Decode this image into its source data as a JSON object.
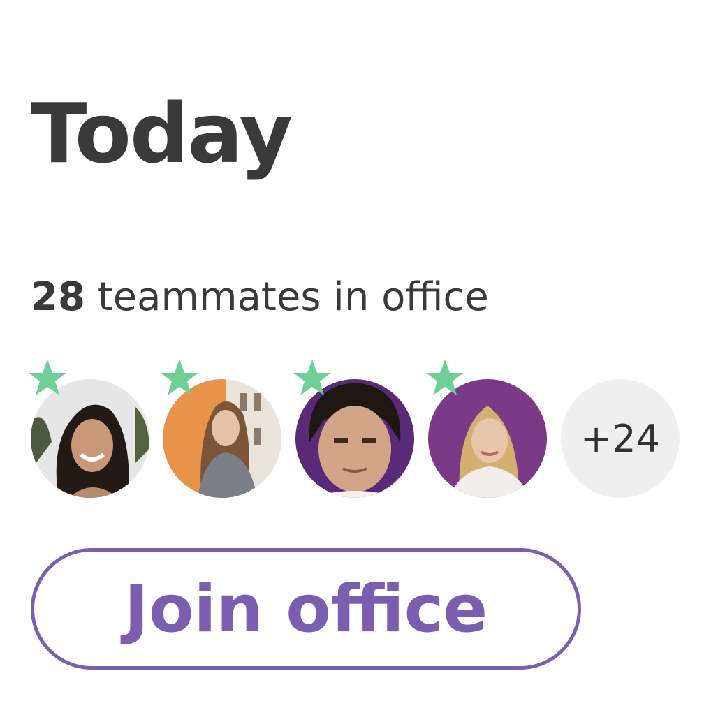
{
  "heading": "Today",
  "teammates": {
    "count": "28",
    "label": " teammates in office"
  },
  "avatars": [
    {
      "name": "avatar-1",
      "starred": true,
      "background": "#e9e9e9"
    },
    {
      "name": "avatar-2",
      "starred": true,
      "background": "#e8934a"
    },
    {
      "name": "avatar-3",
      "starred": true,
      "background": "#5a2a78"
    },
    {
      "name": "avatar-4",
      "starred": true,
      "background": "#7a3a86"
    }
  ],
  "more_count": "+24",
  "join_button": "Join office",
  "colors": {
    "accent": "#7b5eb0",
    "star": "#6fcf97",
    "text": "#3a3a3a"
  }
}
